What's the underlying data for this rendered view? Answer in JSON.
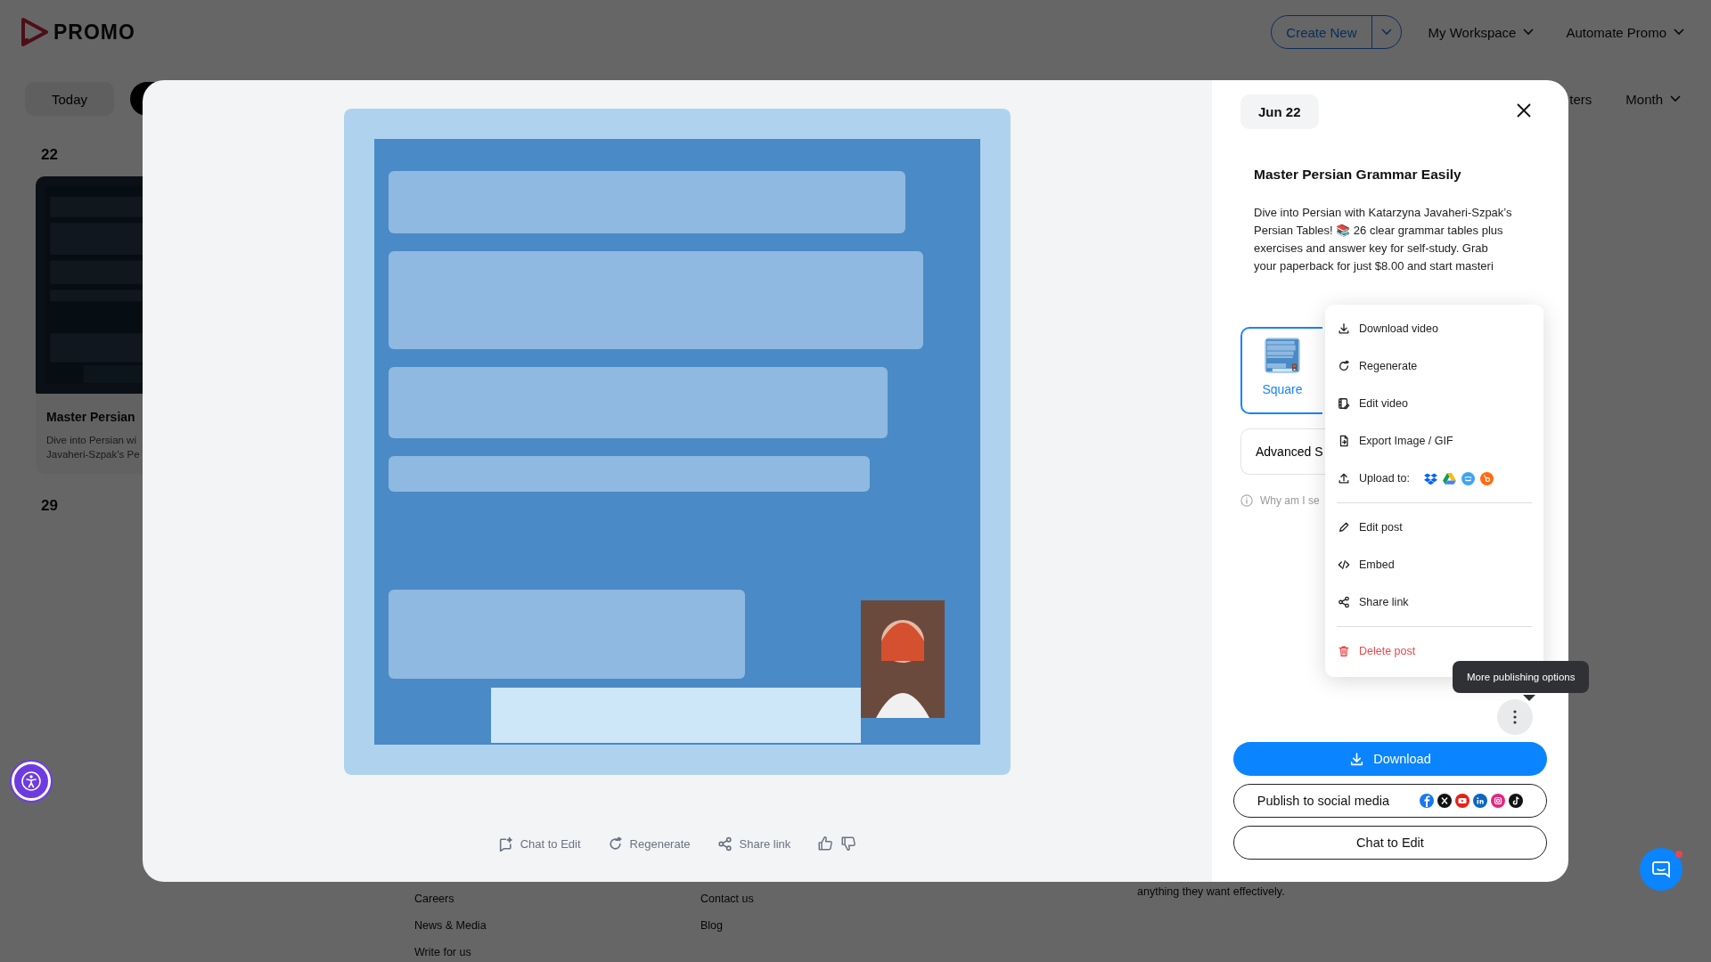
{
  "app": {
    "logo": "PROMO",
    "nav": [
      {
        "label": "Create New",
        "kind": "split"
      },
      {
        "label": "My Workspace",
        "kind": "dropdown"
      },
      {
        "label": "Automate Promo",
        "kind": "dropdown"
      }
    ]
  },
  "toolbar": {
    "today": "Today",
    "modes": [
      {
        "selected": true
      }
    ],
    "filters": "ters",
    "view": "Month"
  },
  "calendar": {
    "days": [
      "22",
      "29"
    ],
    "post": {
      "title": "Master Persian",
      "lines": [
        "Dive into Persian wi",
        "Javaheri-Szpak’s Pe"
      ]
    }
  },
  "footer": {
    "columns": [
      [
        "Careers",
        "News & Media",
        "Write for us"
      ],
      [
        "Contact us",
        "Blog"
      ]
    ],
    "blurb": "anything they want effectively."
  },
  "modal": {
    "video_actions": [
      {
        "label": "Chat to Edit",
        "kind": "chat"
      },
      {
        "label": "Regenerate",
        "kind": "regenerate"
      },
      {
        "label": "Share link",
        "kind": "share"
      }
    ],
    "date": "Jun 22",
    "title": "Master Persian Grammar Easily",
    "description": "Dive into Persian with Katarzyna Javaheri-Szpak’s Persian Tables! 📚 26 clear grammar tables plus exercises and answer key for self-study. Grab your paperback for just $8.00 and start masteri",
    "formats": [
      {
        "label": "Square",
        "selected": true
      }
    ],
    "advanced": "Advanced S",
    "why": "Why am I se",
    "menu": {
      "groups": [
        [
          {
            "label": "Download video",
            "kind": "download"
          },
          {
            "label": "Regenerate",
            "kind": "regenerate"
          },
          {
            "label": "Edit video",
            "kind": "edit-video"
          },
          {
            "label": "Export Image / GIF",
            "kind": "export"
          },
          {
            "label": "Upload to:",
            "kind": "upload"
          }
        ],
        [
          {
            "label": "Edit post",
            "kind": "edit"
          },
          {
            "label": "Embed",
            "kind": "embed"
          },
          {
            "label": "Share link",
            "kind": "share"
          }
        ],
        [
          {
            "label": "Delete post",
            "kind": "delete"
          }
        ]
      ]
    },
    "tooltip": "More publishing options",
    "buttons": [
      {
        "label": "Download",
        "kind": "primary"
      },
      {
        "label": "Publish to social media",
        "kind": "social"
      },
      {
        "label": "Chat to Edit",
        "kind": "outline"
      }
    ]
  }
}
